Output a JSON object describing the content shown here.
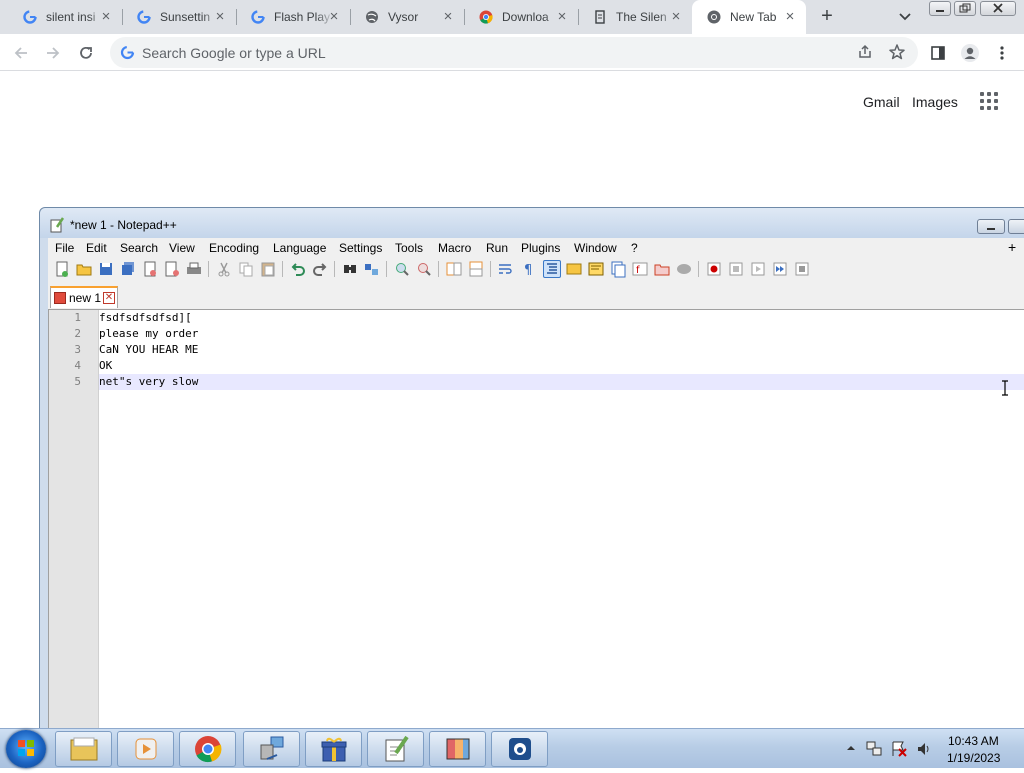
{
  "browser": {
    "tabs": [
      {
        "title": "silent insi",
        "icon": "google-icon"
      },
      {
        "title": "Sunsettin",
        "icon": "google-icon"
      },
      {
        "title": "Flash Play",
        "icon": "google-icon"
      },
      {
        "title": "Vysor",
        "icon": "vysor-globe-icon"
      },
      {
        "title": "Downloa",
        "icon": "chrome-icon"
      },
      {
        "title": "The Silen",
        "icon": "document-icon"
      },
      {
        "title": "New Tab",
        "icon": "chrome-icon",
        "active": true
      }
    ],
    "omnibox_placeholder": "Search Google or type a URL",
    "ntp": {
      "gmail": "Gmail",
      "images": "Images"
    }
  },
  "notepad": {
    "title": "*new 1 - Notepad++",
    "menu": [
      "File",
      "Edit",
      "Search",
      "View",
      "Encoding",
      "Language",
      "Settings",
      "Tools",
      "Macro",
      "Run",
      "Plugins",
      "Window",
      "?"
    ],
    "menu_plus": "+",
    "doc_tab": "new 1",
    "lines": [
      {
        "num": "1",
        "text": "fsdfsdfsdfsd]["
      },
      {
        "num": "2",
        "text": "please my order"
      },
      {
        "num": "3",
        "text": "CaN YOU HEAR ME"
      },
      {
        "num": "4",
        "text": "OK"
      },
      {
        "num": "5",
        "text": "net\"s very slow"
      }
    ]
  },
  "taskbar": {
    "time": "10:43 AM",
    "date": "1/19/2023"
  },
  "colors": {
    "tabstrip": "#dee1e6",
    "omnibox": "#f1f3f4",
    "npp_current_line": "#e8e8ff",
    "taskbar": "#b8cde6"
  }
}
